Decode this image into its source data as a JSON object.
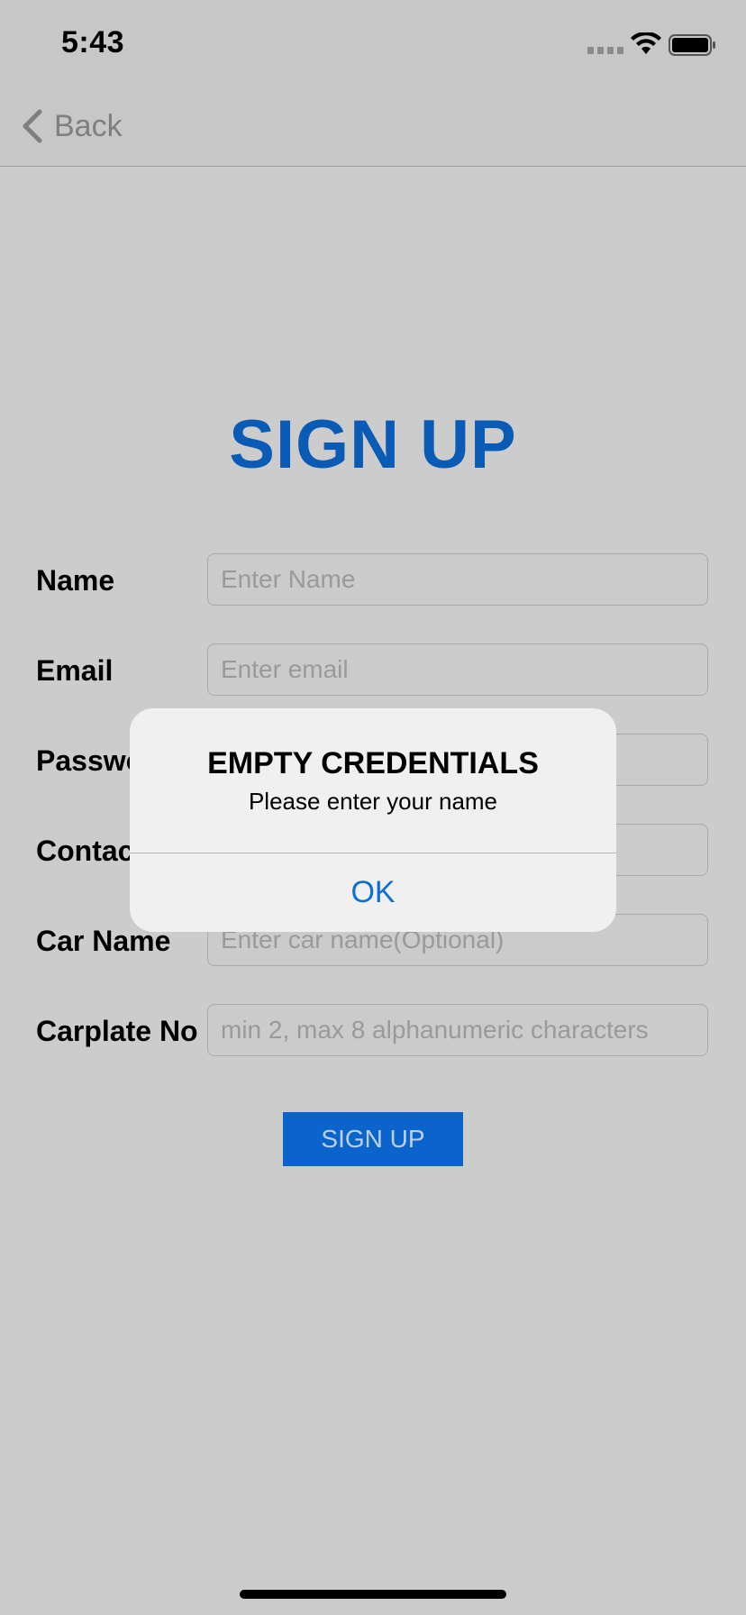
{
  "status_bar": {
    "time": "5:43"
  },
  "nav": {
    "back_label": "Back"
  },
  "page": {
    "title": "SIGN UP"
  },
  "form": {
    "fields": [
      {
        "label": "Name",
        "placeholder": "Enter Name"
      },
      {
        "label": "Email",
        "placeholder": "Enter email"
      },
      {
        "label": "Password",
        "placeholder": ""
      },
      {
        "label": "Contact",
        "placeholder": ""
      },
      {
        "label": "Car Name",
        "placeholder": "Enter car name(Optional)"
      },
      {
        "label": "Carplate No",
        "placeholder": "min 2, max 8 alphanumeric characters"
      }
    ],
    "submit_label": "SIGN UP"
  },
  "alert": {
    "title": "EMPTY CREDENTIALS",
    "message": "Please enter your name",
    "ok_label": "OK"
  }
}
